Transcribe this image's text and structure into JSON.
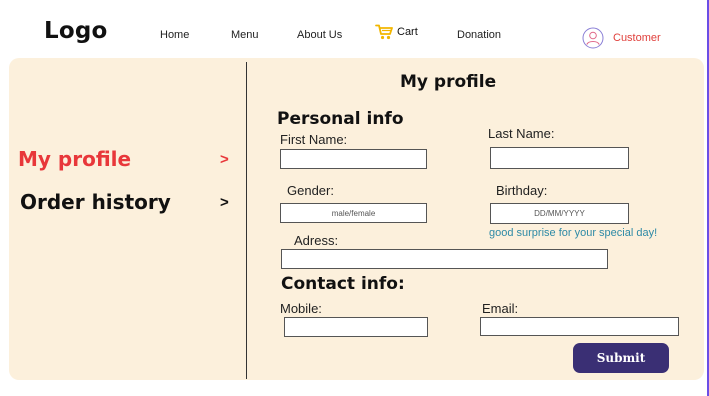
{
  "header": {
    "logo": "Logo",
    "nav": [
      {
        "label": "Home"
      },
      {
        "label": "Menu"
      },
      {
        "label": "About Us"
      },
      {
        "label": "Cart",
        "icon": "cart-icon"
      },
      {
        "label": "Donation"
      }
    ],
    "customer": {
      "label": "Customer",
      "icon": "user-icon"
    }
  },
  "sidebar": {
    "items": [
      {
        "label": "My profile",
        "chevron": ">",
        "active": true
      },
      {
        "label": "Order history",
        "chevron": ">",
        "active": false
      }
    ]
  },
  "main": {
    "title": "My profile",
    "personal": {
      "heading": "Personal  info",
      "first_name_label": "First Name:",
      "first_name_value": "",
      "last_name_label": "Last  Name:",
      "last_name_value": "",
      "gender_label": "Gender:",
      "gender_placeholder": "male/female",
      "birthday_label": "Birthday:",
      "birthday_placeholder": "DD/MM/YYYY",
      "birthday_hint": "good surprise for your special day!",
      "address_label": "Adress:",
      "address_value": ""
    },
    "contact": {
      "heading": "Contact info:",
      "mobile_label": "Mobile:",
      "mobile_value": "",
      "email_label": "Email:",
      "email_value": ""
    },
    "submit_label": "Submit"
  },
  "colors": {
    "panel_bg": "#fcf0dc",
    "accent_red": "#e8373a",
    "submit_bg": "#3a2f74",
    "hint": "#2e8aa6",
    "cart_icon": "#f2b600",
    "right_rule": "#6b4ee6"
  }
}
